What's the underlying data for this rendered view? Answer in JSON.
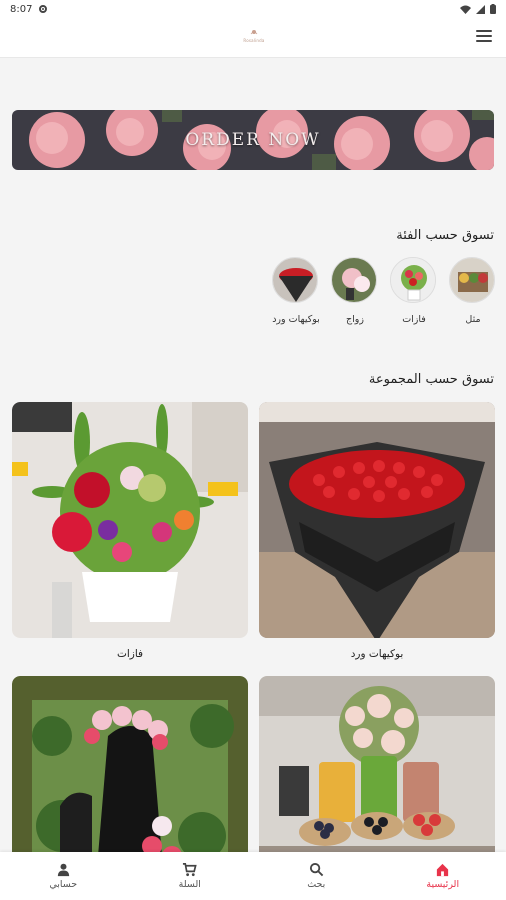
{
  "statusbar": {
    "time": "8:07"
  },
  "app": {
    "logo_text": "Rosalinda",
    "accent": "#e8334a"
  },
  "banner": {
    "text": "ORDER NOW"
  },
  "categories": {
    "title": "تسوق حسب الفئة",
    "items": [
      {
        "label": "مثل"
      },
      {
        "label": "فازات"
      },
      {
        "label": "زواج"
      },
      {
        "label": "بوكيهات ورد"
      }
    ]
  },
  "collections": {
    "title": "تسوق حسب المجموعة",
    "items": [
      {
        "label": "بوكيهات ورد"
      },
      {
        "label": "فازات"
      },
      {
        "label": ""
      },
      {
        "label": ""
      }
    ]
  },
  "nav": {
    "items": [
      {
        "label": "الرئيسية",
        "icon": "home-icon"
      },
      {
        "label": "بحث",
        "icon": "search-icon"
      },
      {
        "label": "السلة",
        "icon": "cart-icon"
      },
      {
        "label": "حسابي",
        "icon": "person-icon"
      }
    ]
  }
}
